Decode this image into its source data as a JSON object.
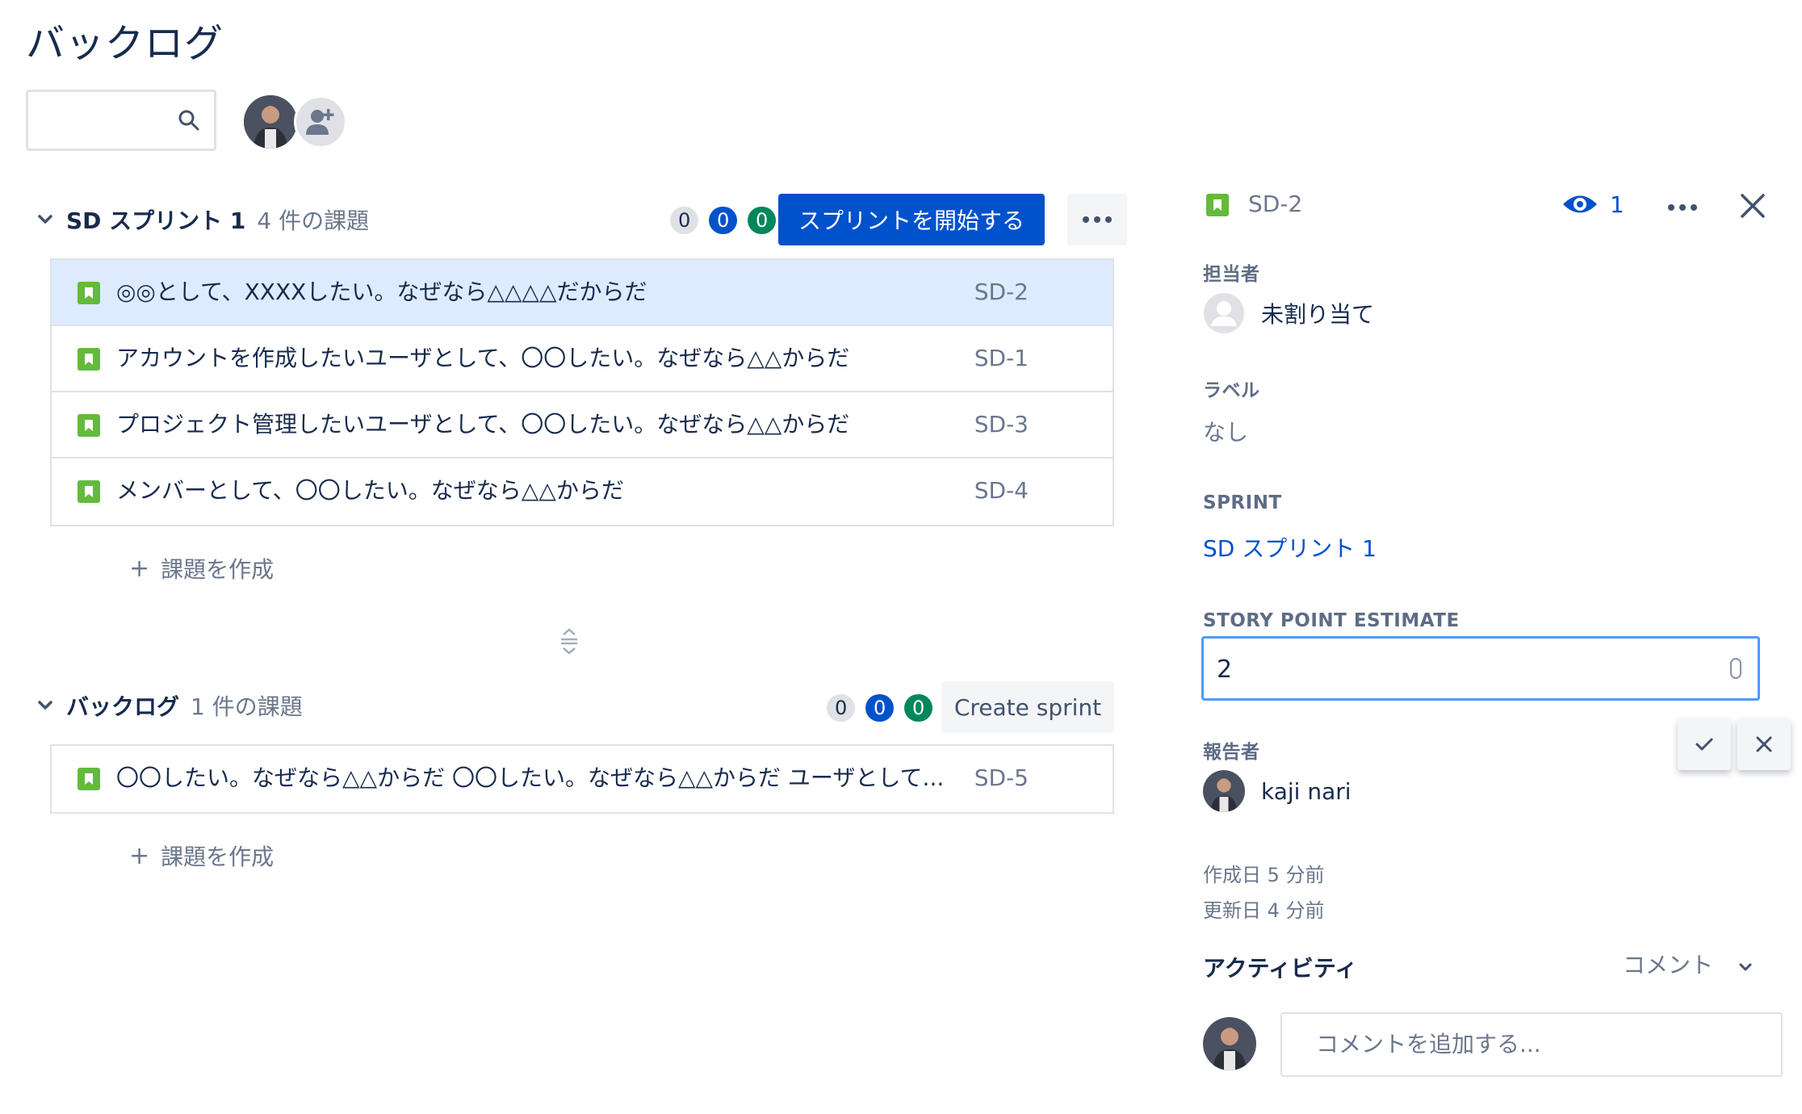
{
  "page": {
    "title": "バックログ"
  },
  "search": {
    "placeholder": ""
  },
  "sprint": {
    "name": "SD スプリント 1",
    "count": "4 件の課題",
    "badges": [
      "0",
      "0",
      "0"
    ],
    "start_button": "スプリントを開始する",
    "issues": [
      {
        "summary": "◎◎として、XXXXしたい。なぜなら△△△△だからだ",
        "key": "SD-2",
        "selected": true
      },
      {
        "summary": "アカウントを作成したいユーザとして、〇〇したい。なぜなら△△からだ",
        "key": "SD-1"
      },
      {
        "summary": "プロジェクト管理したいユーザとして、〇〇したい。なぜなら△△からだ",
        "key": "SD-3"
      },
      {
        "summary": "メンバーとして、〇〇したい。なぜなら△△からだ",
        "key": "SD-4"
      }
    ],
    "create_issue": "課題を作成"
  },
  "backlog": {
    "name": "バックログ",
    "count": "1 件の課題",
    "badges": [
      "0",
      "0",
      "0"
    ],
    "create_sprint_button": "Create sprint",
    "issues": [
      {
        "summary": "〇〇したい。なぜなら△△からだ 〇〇したい。なぜなら△△からだ ユーザとして...",
        "key": "SD-5"
      }
    ],
    "create_issue": "課題を作成"
  },
  "detail": {
    "key": "SD-2",
    "watchers": "1",
    "assignee_label": "担当者",
    "assignee_value": "未割り当て",
    "labels_label": "ラベル",
    "labels_value": "なし",
    "sprint_label": "SPRINT",
    "sprint_value": "SD スプリント 1",
    "story_point_label": "STORY POINT ESTIMATE",
    "story_point_value": "2",
    "reporter_label": "報告者",
    "reporter_value": "kaji nari",
    "created": "作成日 5 分前",
    "updated": "更新日 4 分前",
    "activity_label": "アクティビティ",
    "activity_filter": "コメント",
    "comment_placeholder": "コメントを追加する..."
  },
  "colors": {
    "primary": "#0052cc",
    "success": "#00875a",
    "story": "#63ba3c",
    "selected_row": "#deebff",
    "focus": "#4c9aff"
  }
}
